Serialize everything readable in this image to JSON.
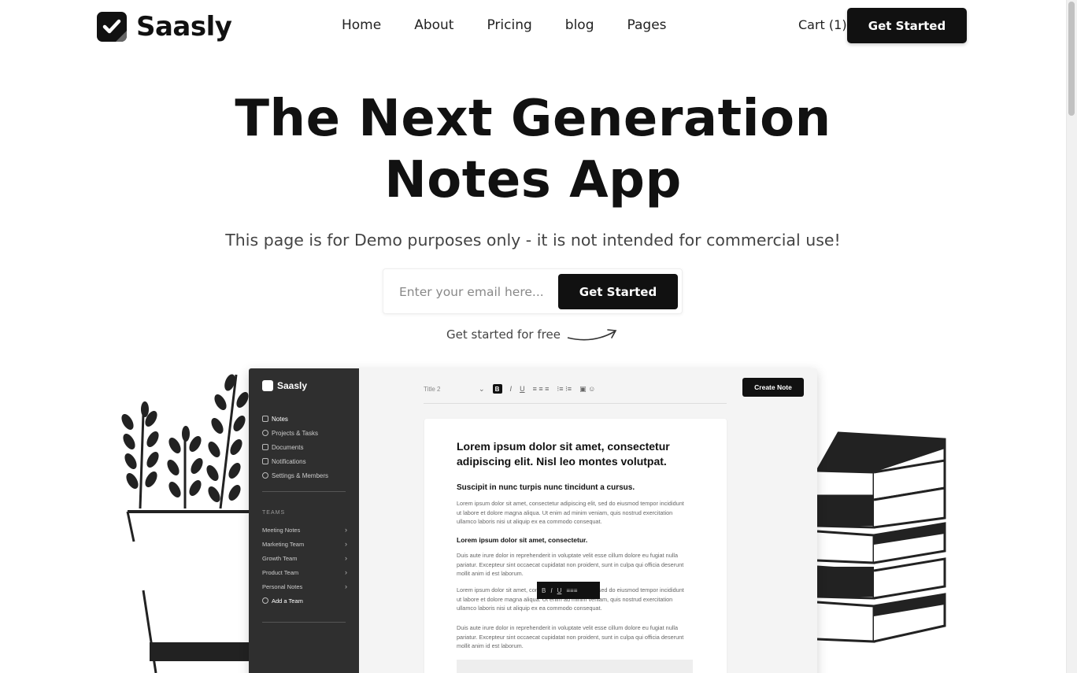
{
  "brand": {
    "name": "Saasly",
    "logo_icon": "checkmark-icon"
  },
  "nav": {
    "items": [
      {
        "label": "Home"
      },
      {
        "label": "About"
      },
      {
        "label": "Pricing"
      },
      {
        "label": "blog"
      },
      {
        "label": "Pages"
      }
    ],
    "cart_label": "Cart (1)",
    "cta_label": "Get Started"
  },
  "hero": {
    "title_line1": "The Next Generation",
    "title_line2": "Notes App",
    "subtitle": "This page is for Demo purposes only - it is not intended for commercial use!",
    "email_placeholder": "Enter your email here...",
    "signup_label": "Get Started",
    "free_note": "Get started for free"
  },
  "mockup": {
    "brand": "Saasly",
    "menu": [
      "Notes",
      "Projects & Tasks",
      "Documents",
      "Notifications",
      "Settings & Members"
    ],
    "teams_label": "TEAMS",
    "teams": [
      "Meeting Notes",
      "Marketing Team",
      "Growth Team",
      "Product Team",
      "Personal Notes"
    ],
    "add_team": "Add a Team",
    "toolbar_style": "Title 2",
    "create_note": "Create Note",
    "doc_title": "Lorem ipsum dolor sit amet, consectetur adipiscing elit. Nisl leo montes volutpat.",
    "doc_h2": "Suscipit in nunc turpis nunc tincidunt a cursus.",
    "doc_p1": "Lorem ipsum dolor sit amet, consectetur adipiscing elit, sed do eiusmod tempor incididunt ut labore et dolore magna aliqua. Ut enim ad minim veniam, quis nostrud exercitation ullamco laboris nisi ut aliquip ex ea commodo consequat.",
    "doc_h3": "Lorem ipsum dolor sit amet, consectetur.",
    "doc_p2": "Duis aute irure dolor in reprehenderit in voluptate velit esse cillum dolore eu fugiat nulla pariatur. Excepteur sint occaecat cupidatat non proident, sunt in culpa qui officia deserunt mollit anim id est laborum.",
    "doc_p3": "Lorem ipsum dolor sit amet, consectetur adipiscing elit, sed do eiusmod tempor incididunt ut labore et dolore magna aliqua. Ut enim ad minim veniam, quis nostrud exercitation ullamco laboris nisi ut aliquip ex ea commodo consequat.",
    "doc_p4": "Duis aute irure dolor in reprehenderit in voluptate velit esse cillum dolore eu fugiat nulla pariatur. Excepteur sint occaecat cupidatat non proident, sunt in culpa qui officia deserunt mollit anim id est laborum."
  },
  "colors": {
    "primary": "#111111",
    "sidebar": "#2f2f2f",
    "text_muted": "#444444"
  }
}
